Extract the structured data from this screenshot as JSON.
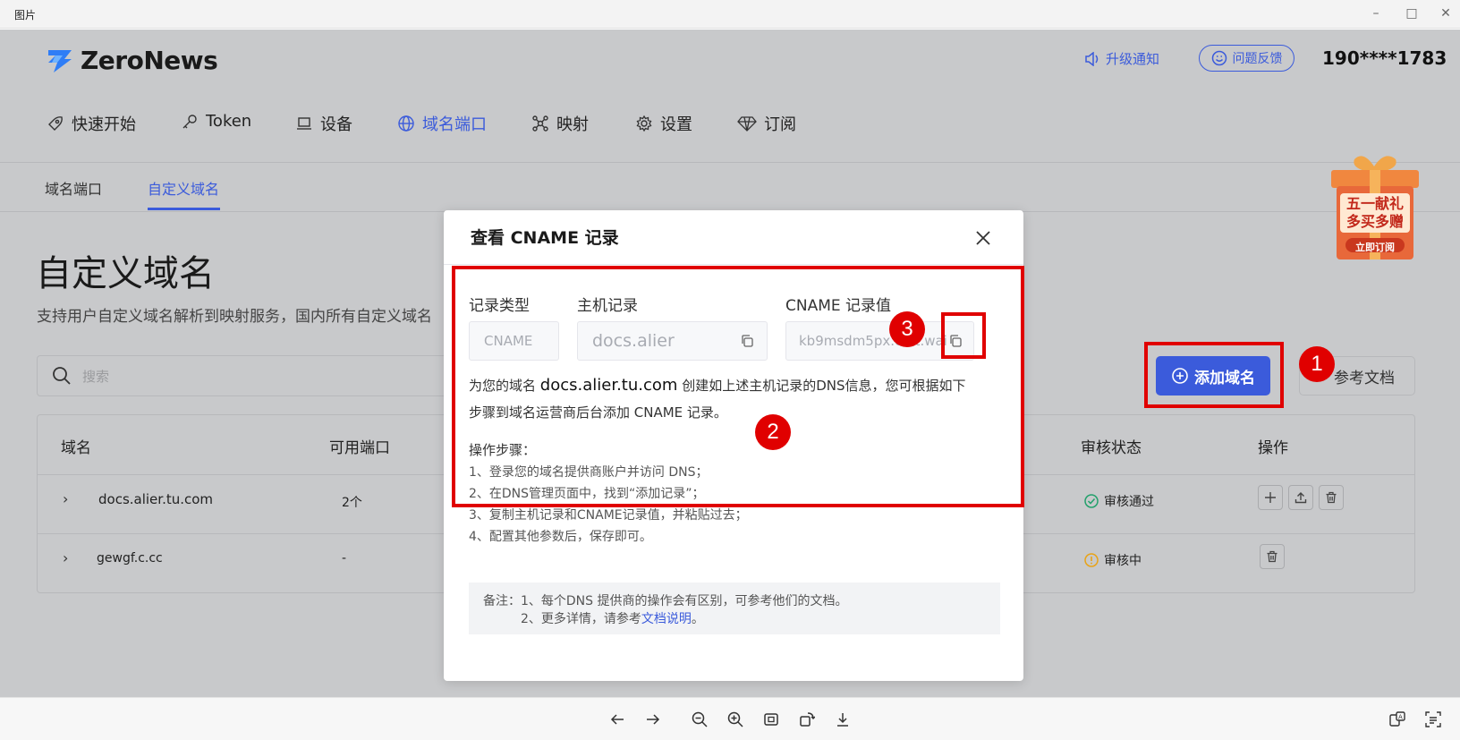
{
  "window": {
    "title": "图片"
  },
  "app": {
    "brand": "ZeroNews",
    "upgrade_notice": "升级通知",
    "feedback": "问题反馈",
    "phone": "190****1783",
    "nav": [
      "快速开始",
      "Token",
      "设备",
      "域名端口",
      "映射",
      "设置",
      "订阅"
    ],
    "subnav": [
      "域名端口",
      "自定义域名"
    ],
    "page_title": "自定义域名",
    "page_desc": "支持用户自定义域名解析到映射服务，国内所有自定义域名",
    "search_placeholder": "搜索",
    "add_domain": "添加域名",
    "ref_doc": "参考文档",
    "promo": {
      "line1": "五一献礼",
      "line2": "多买多赠",
      "cta": "立即订阅"
    },
    "table": {
      "headers": [
        "域名",
        "可用端口",
        "审核状态",
        "操作"
      ],
      "rows": [
        {
          "domain": "docs.alier.tu.com",
          "ports": "2个",
          "status": "审核通过"
        },
        {
          "domain": "gewgf.c.cc",
          "ports": "-",
          "status": "审核中"
        }
      ]
    }
  },
  "modal": {
    "title": "查看 CNAME 记录",
    "labels": [
      "记录类型",
      "主机记录",
      "CNAME 记录值"
    ],
    "record_type": "CNAME",
    "host": "docs.alier",
    "cname_value": "kb9msdm5px.c...t.wai",
    "desc_pre": "为您的域名",
    "desc_domain": "docs.alier.tu.com",
    "desc_post": "创建如上述主机记录的DNS信息，您可根据如下",
    "desc_line2": "步骤到域名运营商后台添加 CNAME 记录。",
    "steps_title": "操作步骤：",
    "steps": [
      "1、登录您的域名提供商账户并访问 DNS；",
      "2、在DNS管理页面中，找到“添加记录”；",
      "3、复制主机记录和CNAME记录值，并粘贴过去；",
      "4、配置其他参数后，保存即可。"
    ],
    "note_line1": "备注：1、每个DNS 提供商的操作会有区别，可参考他们的文档。",
    "note_line2_pre": "2、更多详情，请参考",
    "note_link": "文档说明",
    "note_line2_post": "。"
  },
  "annotations": [
    "1",
    "2",
    "3"
  ],
  "colors": {
    "accent": "#3b5bdb",
    "annotation": "#e00000",
    "success": "#22a06b",
    "warning": "#e8a317"
  }
}
